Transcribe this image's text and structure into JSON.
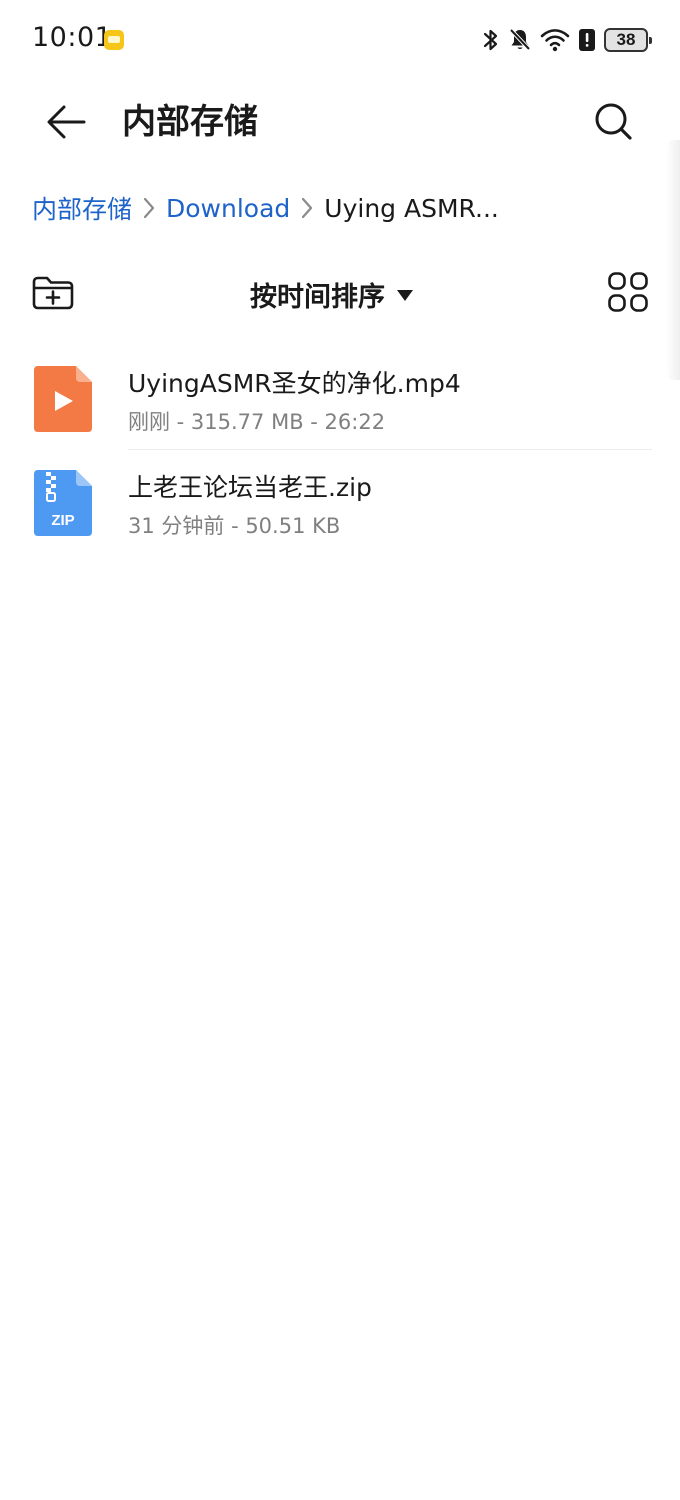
{
  "status_bar": {
    "time": "10:01",
    "battery_level": "38",
    "icons": [
      "bluetooth-icon",
      "mute-bell-icon",
      "wifi-icon",
      "alert-icon",
      "battery-icon"
    ]
  },
  "app_bar": {
    "title": "内部存储",
    "back_icon": "arrow-left-icon",
    "search_icon": "search-icon"
  },
  "breadcrumb": {
    "items": [
      {
        "label": "内部存储"
      },
      {
        "label": "Download"
      },
      {
        "label": "Uying ASMR..."
      }
    ]
  },
  "toolbar": {
    "sort_label": "按时间排序",
    "new_folder_icon": "new-folder-icon",
    "grid_icon": "grid-view-icon"
  },
  "files": [
    {
      "name": "UyingASMR圣女的净化.mp4",
      "meta": "刚刚 - 315.77 MB - 26:22",
      "type": "video",
      "icon": "video-file-icon",
      "color": "#f47a45"
    },
    {
      "name": "上老王论坛当老王.zip",
      "meta": "31 分钟前 - 50.51 KB",
      "type": "zip",
      "icon": "zip-file-icon",
      "color": "#4e99f2",
      "icon_label": "ZIP"
    }
  ],
  "colors": {
    "accent": "#1e63c9",
    "text_primary": "#1a1a1a",
    "text_secondary": "#808080"
  }
}
